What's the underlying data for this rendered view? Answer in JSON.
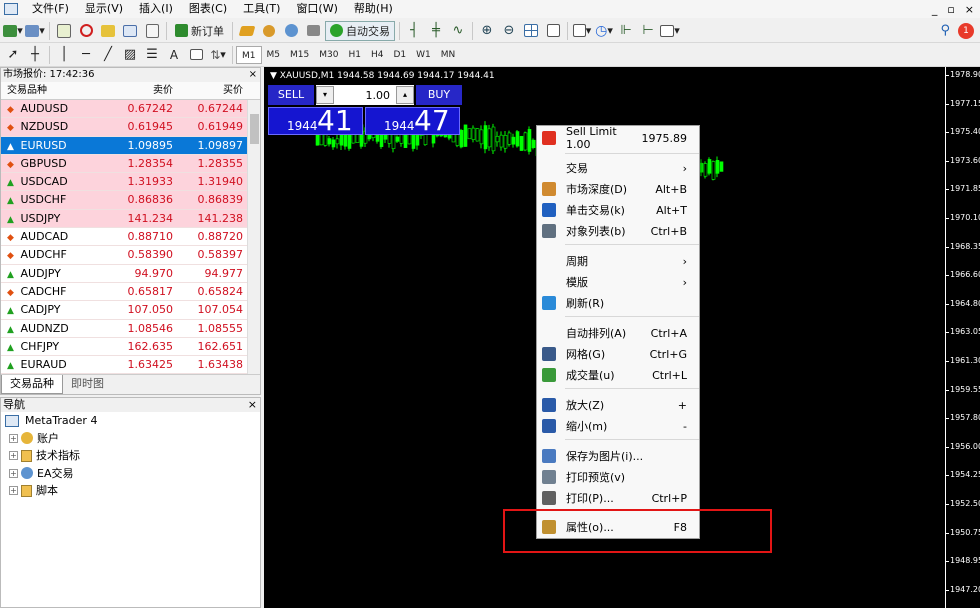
{
  "menu": [
    "文件(F)",
    "显示(V)",
    "插入(I)",
    "图表(C)",
    "工具(T)",
    "窗口(W)",
    "帮助(H)"
  ],
  "menu_right": {
    "min": "_",
    "restore": "▫",
    "close": "×",
    "notif_count": "1"
  },
  "toolbar": {
    "new_order": "新订单",
    "auto_trade": "自动交易"
  },
  "timeframes": [
    "M1",
    "M5",
    "M15",
    "M30",
    "H1",
    "H4",
    "D1",
    "W1",
    "MN"
  ],
  "market_watch": {
    "title": "市场报价: 17:42:36",
    "headers": {
      "symbol": "交易品种",
      "bid": "卖价",
      "ask": "买价"
    },
    "rows": [
      {
        "symbol": "AUDUSD",
        "bid": "0.67242",
        "ask": "0.67244",
        "style": "pink",
        "dir": "down"
      },
      {
        "symbol": "NZDUSD",
        "bid": "0.61945",
        "ask": "0.61949",
        "style": "pink",
        "dir": "down"
      },
      {
        "symbol": "EURUSD",
        "bid": "1.09895",
        "ask": "1.09897",
        "style": "sel",
        "dir": "up"
      },
      {
        "symbol": "GBPUSD",
        "bid": "1.28354",
        "ask": "1.28355",
        "style": "pink",
        "dir": "down"
      },
      {
        "symbol": "USDCAD",
        "bid": "1.31933",
        "ask": "1.31940",
        "style": "pink",
        "dir": "up"
      },
      {
        "symbol": "USDCHF",
        "bid": "0.86836",
        "ask": "0.86839",
        "style": "pink",
        "dir": "up"
      },
      {
        "symbol": "USDJPY",
        "bid": "141.234",
        "ask": "141.238",
        "style": "pink",
        "dir": "up"
      },
      {
        "symbol": "AUDCAD",
        "bid": "0.88710",
        "ask": "0.88720",
        "style": "white",
        "dir": "down"
      },
      {
        "symbol": "AUDCHF",
        "bid": "0.58390",
        "ask": "0.58397",
        "style": "white",
        "dir": "down"
      },
      {
        "symbol": "AUDJPY",
        "bid": "94.970",
        "ask": "94.977",
        "style": "white",
        "dir": "up"
      },
      {
        "symbol": "CADCHF",
        "bid": "0.65817",
        "ask": "0.65824",
        "style": "white",
        "dir": "down"
      },
      {
        "symbol": "CADJPY",
        "bid": "107.050",
        "ask": "107.054",
        "style": "white",
        "dir": "up"
      },
      {
        "symbol": "AUDNZD",
        "bid": "1.08546",
        "ask": "1.08555",
        "style": "white",
        "dir": "up"
      },
      {
        "symbol": "CHFJPY",
        "bid": "162.635",
        "ask": "162.651",
        "style": "white",
        "dir": "up"
      },
      {
        "symbol": "EURAUD",
        "bid": "1.63425",
        "ask": "1.63438",
        "style": "white",
        "dir": "up"
      }
    ],
    "tabs": [
      "交易品种",
      "即时图"
    ]
  },
  "navigator": {
    "title": "导航",
    "root": "MetaTrader 4",
    "items": [
      "账户",
      "技术指标",
      "EA交易",
      "脚本"
    ]
  },
  "chart": {
    "title": "XAUUSD,M1  1944.58 1944.69 1944.17 1944.41",
    "sell_label": "SELL",
    "buy_label": "BUY",
    "lot": "1.00",
    "sell_small": "1944",
    "sell_big": "41",
    "buy_small": "1944",
    "buy_big": "47",
    "y_ticks": [
      "1978.90",
      "1977.15",
      "1975.40",
      "1973.60",
      "1971.85",
      "1970.10",
      "1968.35",
      "1966.60",
      "1964.80",
      "1963.05",
      "1961.30",
      "1959.55",
      "1957.80",
      "1956.00",
      "1954.25",
      "1952.50",
      "1950.75",
      "1948.95",
      "1947.20"
    ]
  },
  "context_menu": [
    {
      "label": "Sell Limit 1.00",
      "shortcut": "1975.89",
      "icon": "sell-limit-icon"
    },
    {
      "label": "交易",
      "shortcut": "›",
      "icon": ""
    },
    {
      "label": "市场深度(D)",
      "shortcut": "Alt+B",
      "icon": "market-depth-icon"
    },
    {
      "label": "单击交易(k)",
      "shortcut": "Alt+T",
      "icon": "one-click-icon"
    },
    {
      "label": "对象列表(b)",
      "shortcut": "Ctrl+B",
      "icon": "objects-icon"
    },
    {
      "label": "周期",
      "shortcut": "›",
      "icon": ""
    },
    {
      "label": "模版",
      "shortcut": "›",
      "icon": ""
    },
    {
      "label": "刷新(R)",
      "shortcut": "",
      "icon": "refresh-icon"
    },
    {
      "label": "自动排列(A)",
      "shortcut": "Ctrl+A",
      "icon": ""
    },
    {
      "label": "网格(G)",
      "shortcut": "Ctrl+G",
      "icon": "grid-icon"
    },
    {
      "label": "成交量(u)",
      "shortcut": "Ctrl+L",
      "icon": "volume-icon"
    },
    {
      "label": "放大(Z)",
      "shortcut": "+",
      "icon": "zoom-in-icon"
    },
    {
      "label": "缩小(m)",
      "shortcut": "-",
      "icon": "zoom-out-icon"
    },
    {
      "label": "保存为图片(i)...",
      "shortcut": "",
      "icon": "save-picture-icon"
    },
    {
      "label": "打印预览(v)",
      "shortcut": "",
      "icon": "print-preview-icon"
    },
    {
      "label": "打印(P)...",
      "shortcut": "Ctrl+P",
      "icon": "print-icon"
    },
    {
      "label": "属性(o)...",
      "shortcut": "F8",
      "icon": "properties-icon"
    }
  ],
  "colors": {
    "bull": "#00ff00",
    "bear": "#00ff00",
    "highlight": "#e21515",
    "selected_row": "#0a78d7"
  }
}
